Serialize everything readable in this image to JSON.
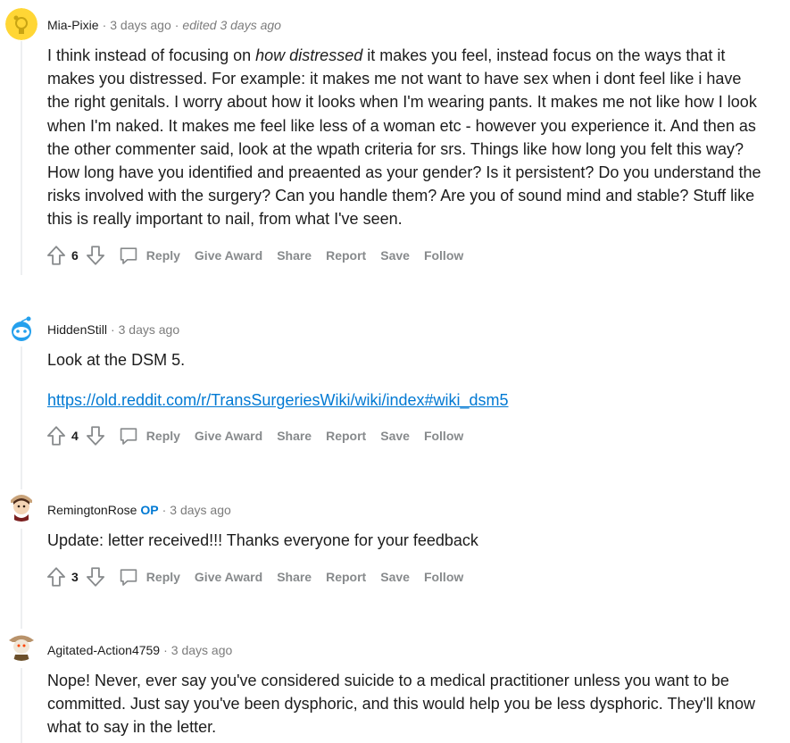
{
  "comments": [
    {
      "username": "Mia-Pixie",
      "op_badge": "",
      "time": "3 days ago",
      "edited": "edited 3 days ago",
      "body_before": "I think instead of focusing on ",
      "body_italic": "how distressed",
      "body_after": " it makes you feel, instead focus on the ways that it makes you distressed. For example: it makes me not want to have sex when i dont feel like i have the right genitals. I worry about how it looks when I'm wearing pants. It makes me not like how I look when I'm naked. It makes me feel like less of a woman etc - however you experience it. And then as the other commenter said, look at the wpath criteria for srs. Things like how long you felt this way? How long have you identified and preaented as your gender? Is it persistent? Do you understand the risks involved with the surgery? Can you handle them? Are you of sound mind and stable? Stuff like this is really important to nail, from what I've seen.",
      "score": "6"
    },
    {
      "username": "HiddenStill",
      "time": "3 days ago",
      "body": "Look at the DSM 5.",
      "link": "https://old.reddit.com/r/TransSurgeriesWiki/wiki/index#wiki_dsm5",
      "score": "4"
    },
    {
      "username": "RemingtonRose",
      "op_badge": "OP",
      "time": "3 days ago",
      "body": "Update: letter received!!! Thanks everyone for your feedback",
      "score": "3"
    },
    {
      "username": "Agitated-Action4759",
      "time": "3 days ago",
      "body": "Nope! Never, ever say you've considered suicide to a medical practitioner unless you want to be committed. Just say you've been dysphoric, and this would help you be less dysphoric. They'll know what to say in the letter."
    }
  ],
  "actions": {
    "reply": "Reply",
    "give_award": "Give Award",
    "share": "Share",
    "report": "Report",
    "save": "Save",
    "follow": "Follow"
  },
  "icons": {
    "upvote": "upvote-arrow-icon",
    "downvote": "downvote-arrow-icon",
    "reply": "speech-bubble-icon"
  },
  "colors": {
    "link": "#0079d3",
    "op": "#0079d3",
    "muted": "#878a8c"
  }
}
